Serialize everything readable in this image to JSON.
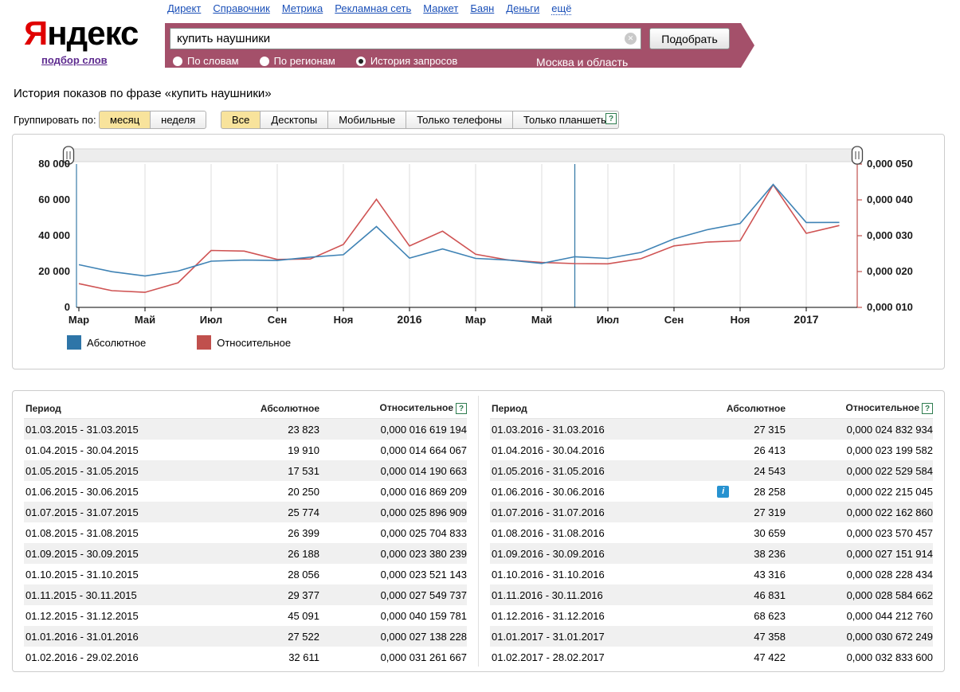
{
  "nav": {
    "links": [
      {
        "label": "Директ",
        "dotted": false
      },
      {
        "label": "Справочник",
        "dotted": false
      },
      {
        "label": "Метрика",
        "dotted": false
      },
      {
        "label": "Рекламная сеть",
        "dotted": false
      },
      {
        "label": "Маркет",
        "dotted": false
      },
      {
        "label": "Баян",
        "dotted": false
      },
      {
        "label": "Деньги",
        "dotted": false
      },
      {
        "label": "ещё",
        "dotted": true
      }
    ]
  },
  "logo": {
    "first": "Я",
    "rest": "ндекс",
    "sub_link": "подбор слов"
  },
  "search": {
    "query": "купить наушники",
    "submit_label": "Подобрать",
    "region_label": "Москва и область",
    "modes": [
      {
        "label": "По словам",
        "selected": false
      },
      {
        "label": "По регионам",
        "selected": false
      },
      {
        "label": "История запросов",
        "selected": true
      }
    ]
  },
  "page": {
    "title": "История показов по фразе «купить наушники»"
  },
  "filters": {
    "group_label": "Группировать по:",
    "group_options": [
      {
        "label": "месяц",
        "selected": true
      },
      {
        "label": "неделя",
        "selected": false
      }
    ],
    "device_options": [
      {
        "label": "Все",
        "selected": true
      },
      {
        "label": "Десктопы",
        "selected": false
      },
      {
        "label": "Мобильные",
        "selected": false
      },
      {
        "label": "Только телефоны",
        "selected": false
      },
      {
        "label": "Только планшеты",
        "selected": false
      }
    ],
    "help_label": "?"
  },
  "chart_data": {
    "type": "line",
    "x_ticks": [
      {
        "i": 0,
        "label": "Мар",
        "year": false
      },
      {
        "i": 2,
        "label": "Май",
        "year": false
      },
      {
        "i": 4,
        "label": "Июл",
        "year": false
      },
      {
        "i": 6,
        "label": "Сен",
        "year": false
      },
      {
        "i": 8,
        "label": "Ноя",
        "year": false
      },
      {
        "i": 10,
        "label": "2016",
        "year": true
      },
      {
        "i": 12,
        "label": "Мар",
        "year": false
      },
      {
        "i": 14,
        "label": "Май",
        "year": false
      },
      {
        "i": 16,
        "label": "Июл",
        "year": false
      },
      {
        "i": 18,
        "label": "Сен",
        "year": false
      },
      {
        "i": 20,
        "label": "Ноя",
        "year": false
      },
      {
        "i": 22,
        "label": "2017",
        "year": true
      }
    ],
    "left_axis": {
      "ticks": [
        "0",
        "20 000",
        "40 000",
        "60 000",
        "80 000"
      ],
      "min": 0,
      "max": 80000,
      "color": "#3a7ca8"
    },
    "right_axis": {
      "ticks": [
        "0,000 010",
        "0,000 020",
        "0,000 030",
        "0,000 040",
        "0,000 050"
      ],
      "min_micro": 10,
      "max_micro": 50,
      "color": "#c0504d"
    },
    "series": [
      {
        "name": "Абсолютное",
        "axis": "left",
        "color": "#3f83b5",
        "values": [
          23823,
          19910,
          17531,
          20250,
          25774,
          26399,
          26188,
          28056,
          29377,
          45091,
          27522,
          32611,
          27315,
          26413,
          24543,
          28258,
          27319,
          30659,
          38236,
          43316,
          46831,
          68623,
          47358,
          47422
        ]
      },
      {
        "name": "Относительное",
        "axis": "right",
        "color": "#cf5353",
        "values_micro": [
          16.619194,
          14.664067,
          14.190663,
          16.869209,
          25.896909,
          25.704833,
          23.380239,
          23.521143,
          27.549737,
          40.159781,
          27.138228,
          31.261667,
          24.832934,
          23.199582,
          22.529584,
          22.215045,
          22.16286,
          23.570457,
          27.151914,
          28.228434,
          28.584662,
          44.21276,
          30.672249,
          32.8336
        ]
      }
    ],
    "marker_index": 15,
    "grid": true,
    "legend_position": "bottom-left"
  },
  "legend": [
    {
      "label": "Абсолютное",
      "color": "#2e75a8"
    },
    {
      "label": "Относительное",
      "color": "#c0504d"
    }
  ],
  "tables": [
    {
      "headers": [
        "Период",
        "Абсолютное",
        "Относительное"
      ],
      "rows": [
        {
          "period": "01.03.2015 - 31.03.2015",
          "absolute": "23 823",
          "relative": "0,000 016 619 194",
          "info": false
        },
        {
          "period": "01.04.2015 - 30.04.2015",
          "absolute": "19 910",
          "relative": "0,000 014 664 067",
          "info": false
        },
        {
          "period": "01.05.2015 - 31.05.2015",
          "absolute": "17 531",
          "relative": "0,000 014 190 663",
          "info": false
        },
        {
          "period": "01.06.2015 - 30.06.2015",
          "absolute": "20 250",
          "relative": "0,000 016 869 209",
          "info": false
        },
        {
          "period": "01.07.2015 - 31.07.2015",
          "absolute": "25 774",
          "relative": "0,000 025 896 909",
          "info": false
        },
        {
          "period": "01.08.2015 - 31.08.2015",
          "absolute": "26 399",
          "relative": "0,000 025 704 833",
          "info": false
        },
        {
          "period": "01.09.2015 - 30.09.2015",
          "absolute": "26 188",
          "relative": "0,000 023 380 239",
          "info": false
        },
        {
          "period": "01.10.2015 - 31.10.2015",
          "absolute": "28 056",
          "relative": "0,000 023 521 143",
          "info": false
        },
        {
          "period": "01.11.2015 - 30.11.2015",
          "absolute": "29 377",
          "relative": "0,000 027 549 737",
          "info": false
        },
        {
          "period": "01.12.2015 - 31.12.2015",
          "absolute": "45 091",
          "relative": "0,000 040 159 781",
          "info": false
        },
        {
          "period": "01.01.2016 - 31.01.2016",
          "absolute": "27 522",
          "relative": "0,000 027 138 228",
          "info": false
        },
        {
          "period": "01.02.2016 - 29.02.2016",
          "absolute": "32 611",
          "relative": "0,000 031 261 667",
          "info": false
        }
      ]
    },
    {
      "headers": [
        "Период",
        "Абсолютное",
        "Относительное"
      ],
      "rows": [
        {
          "period": "01.03.2016 - 31.03.2016",
          "absolute": "27 315",
          "relative": "0,000 024 832 934",
          "info": false
        },
        {
          "period": "01.04.2016 - 30.04.2016",
          "absolute": "26 413",
          "relative": "0,000 023 199 582",
          "info": false
        },
        {
          "period": "01.05.2016 - 31.05.2016",
          "absolute": "24 543",
          "relative": "0,000 022 529 584",
          "info": false
        },
        {
          "period": "01.06.2016 - 30.06.2016",
          "absolute": "28 258",
          "relative": "0,000 022 215 045",
          "info": true
        },
        {
          "period": "01.07.2016 - 31.07.2016",
          "absolute": "27 319",
          "relative": "0,000 022 162 860",
          "info": false
        },
        {
          "period": "01.08.2016 - 31.08.2016",
          "absolute": "30 659",
          "relative": "0,000 023 570 457",
          "info": false
        },
        {
          "period": "01.09.2016 - 30.09.2016",
          "absolute": "38 236",
          "relative": "0,000 027 151 914",
          "info": false
        },
        {
          "period": "01.10.2016 - 31.10.2016",
          "absolute": "43 316",
          "relative": "0,000 028 228 434",
          "info": false
        },
        {
          "period": "01.11.2016 - 30.11.2016",
          "absolute": "46 831",
          "relative": "0,000 028 584 662",
          "info": false
        },
        {
          "period": "01.12.2016 - 31.12.2016",
          "absolute": "68 623",
          "relative": "0,000 044 212 760",
          "info": false
        },
        {
          "period": "01.01.2017 - 31.01.2017",
          "absolute": "47 358",
          "relative": "0,000 030 672 249",
          "info": false
        },
        {
          "period": "01.02.2017 - 28.02.2017",
          "absolute": "47 422",
          "relative": "0,000 032 833 600",
          "info": false
        }
      ]
    }
  ],
  "colors": {
    "header_band": "#a4506a",
    "link": "#1b50b8",
    "visited_link": "#5e2b8f",
    "stripe": "#f0f0f0"
  }
}
